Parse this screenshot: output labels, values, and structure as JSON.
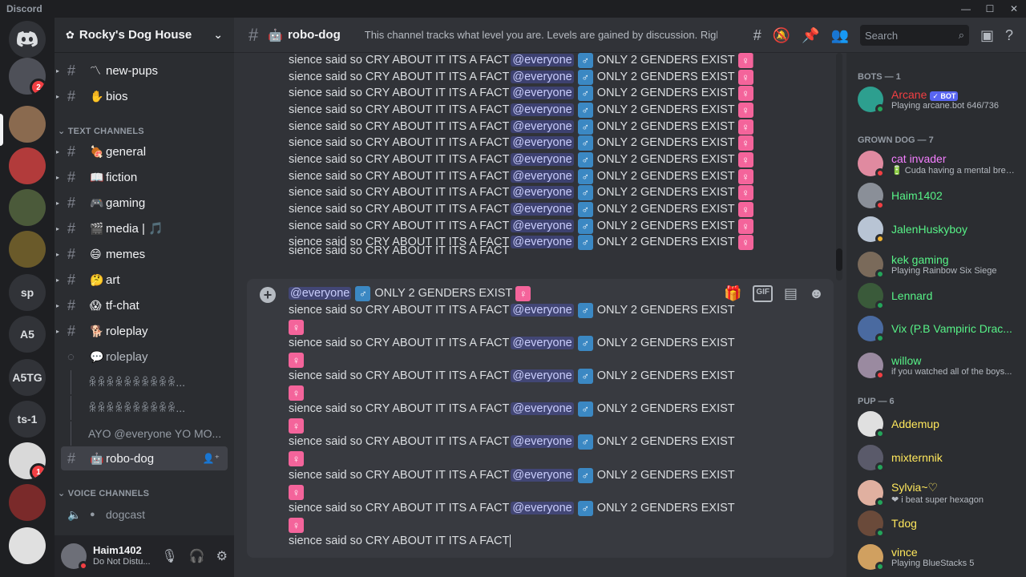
{
  "titlebar": {
    "app": "Discord"
  },
  "servers": [
    {
      "label": "",
      "color": "#4e5058",
      "badge": "2"
    },
    {
      "label": "",
      "color": "#8a6a4f",
      "badge": ""
    },
    {
      "label": "",
      "color": "#b23b3b",
      "badge": ""
    },
    {
      "label": "",
      "color": "#4b5a3a",
      "badge": ""
    },
    {
      "label": "",
      "color": "#6a5a2a",
      "badge": ""
    },
    {
      "label": "sp",
      "color": "#313338",
      "badge": ""
    },
    {
      "label": "A5",
      "color": "#313338",
      "badge": ""
    },
    {
      "label": "A5TG",
      "color": "#313338",
      "badge": ""
    },
    {
      "label": "ts-1",
      "color": "#313338",
      "badge": ""
    },
    {
      "label": "",
      "color": "#d9d9d9",
      "badge": "1"
    },
    {
      "label": "",
      "color": "#7a2a2a",
      "badge": ""
    },
    {
      "label": "",
      "color": "#e0e0e0",
      "badge": ""
    }
  ],
  "guild": {
    "name": "Rocky's Dog House"
  },
  "channels_top": [
    {
      "emoji": "〽",
      "name": "new-pups"
    },
    {
      "emoji": "✋",
      "name": "bios"
    }
  ],
  "text_category": "TEXT CHANNELS",
  "text_channels": [
    {
      "emoji": "🍖",
      "name": "general"
    },
    {
      "emoji": "📖",
      "name": "fiction"
    },
    {
      "emoji": "🎮",
      "name": "gaming"
    },
    {
      "emoji": "🎬",
      "name": "media | 🎵"
    },
    {
      "emoji": "😄",
      "name": "memes"
    },
    {
      "emoji": "🤔",
      "name": "art"
    },
    {
      "emoji": "😱",
      "name": "tf-chat"
    },
    {
      "emoji": "🐕",
      "name": "roleplay"
    }
  ],
  "forum": {
    "name": "roleplay"
  },
  "threads": [
    "ꆜꆜꆜꆜꆜꆜꆜꆜꆜꆜ...",
    "ꆜꆜꆜꆜꆜꆜꆜꆜꆜꆜ...",
    "AYO @everyone YO MO..."
  ],
  "active_channel": {
    "emoji": "🤖",
    "name": "robo-dog"
  },
  "voice_category": "VOICE CHANNELS",
  "voice_channels": [
    {
      "name": "dogcast"
    }
  ],
  "user": {
    "name": "Haim1402",
    "status": "Do Not Distu..."
  },
  "header": {
    "channel": "robo-dog",
    "topic": "This channel tracks what level you are. Levels are gained by discussion. Righ...",
    "search_placeholder": "Search"
  },
  "message": {
    "prefix": "sience said so CRY ABOUT IT ITS A FACT",
    "mention": "@everyone",
    "male": "♂",
    "genders": "ONLY 2 GENDERS EXIST",
    "female": "♀"
  },
  "members": {
    "categories": [
      "BOTS — 1",
      "GROWN DOG — 7",
      "PUP — 6"
    ],
    "list": [
      {
        "name": "Arcane",
        "status": "Playing arcane.bot 646/736",
        "color": "#f23f43",
        "bot": "✓ BOT",
        "avatar": "#2d9f8f",
        "dot": "#23a55a"
      },
      {
        "name": "cat invader",
        "status": "🔋 Cuda having a mental brea...",
        "color": "#f47fff",
        "bot": "",
        "avatar": "#e08aa0",
        "dot": "#f23f43"
      },
      {
        "name": "Haim1402",
        "status": "",
        "color": "#57f287",
        "bot": "",
        "avatar": "#8a8f98",
        "dot": "#f23f43"
      },
      {
        "name": "JalenHuskyboy",
        "status": "",
        "color": "#57f287",
        "bot": "",
        "avatar": "#b8c4d4",
        "dot": "#f0b232"
      },
      {
        "name": "kek gaming",
        "status": "Playing Rainbow Six Siege",
        "color": "#57f287",
        "bot": "",
        "avatar": "#7a6a5a",
        "dot": "#23a55a"
      },
      {
        "name": "Lennard",
        "status": "",
        "color": "#57f287",
        "bot": "",
        "avatar": "#3a5a3a",
        "dot": "#23a55a"
      },
      {
        "name": "Vix (P.B Vampiric Drac...",
        "status": "",
        "color": "#57f287",
        "bot": "",
        "avatar": "#4a6aa0",
        "dot": "#23a55a"
      },
      {
        "name": "willow",
        "status": "if you watched all of the boys...",
        "color": "#57f287",
        "bot": "",
        "avatar": "#9a8aa0",
        "dot": "#f23f43"
      },
      {
        "name": "Addemup",
        "status": "",
        "color": "#fee75c",
        "bot": "",
        "avatar": "#e0e0e0",
        "dot": "#23a55a"
      },
      {
        "name": "mixternnik",
        "status": "",
        "color": "#fee75c",
        "bot": "",
        "avatar": "#5a5a6a",
        "dot": "#23a55a"
      },
      {
        "name": "Sylvia~♡",
        "status": "❤ i beat super hexagon",
        "color": "#fee75c",
        "bot": "",
        "avatar": "#e0b0a0",
        "dot": "#23a55a"
      },
      {
        "name": "Tdog",
        "status": "",
        "color": "#fee75c",
        "bot": "",
        "avatar": "#6a4a3a",
        "dot": "#23a55a"
      },
      {
        "name": "vince",
        "status": "Playing BlueStacks 5",
        "color": "#fee75c",
        "bot": "",
        "avatar": "#d0a060",
        "dot": "#23a55a"
      }
    ]
  }
}
